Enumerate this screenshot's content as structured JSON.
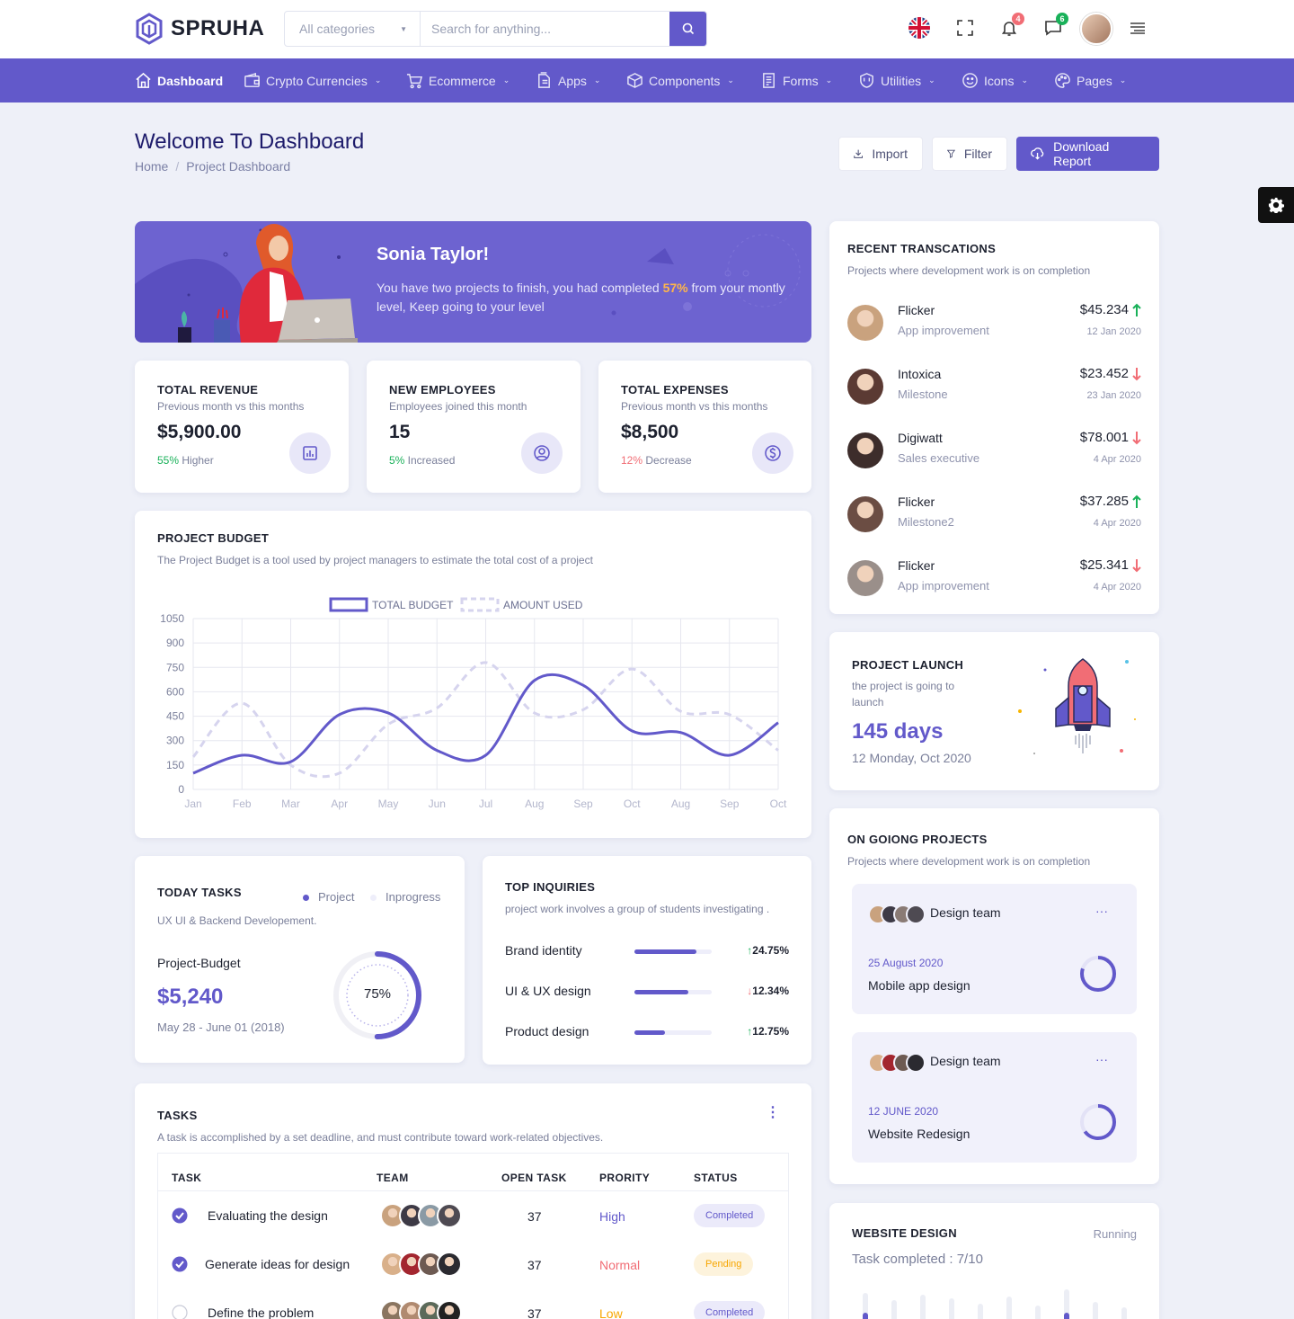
{
  "brand": {
    "name": "SPRUHA"
  },
  "search": {
    "category": "All categories",
    "placeholder": "Search for anything..."
  },
  "header": {
    "notifications_count": "4",
    "messages_count": "6"
  },
  "nav": {
    "items": [
      {
        "label": "Dashboard",
        "icon": "home-icon"
      },
      {
        "label": "Crypto Currencies",
        "icon": "wallet-icon"
      },
      {
        "label": "Ecommerce",
        "icon": "cart-icon"
      },
      {
        "label": "Apps",
        "icon": "files-icon"
      },
      {
        "label": "Components",
        "icon": "box-icon"
      },
      {
        "label": "Forms",
        "icon": "form-icon"
      },
      {
        "label": "Utilities",
        "icon": "shield-icon"
      },
      {
        "label": "Icons",
        "icon": "smile-icon"
      },
      {
        "label": "Pages",
        "icon": "palette-icon"
      }
    ]
  },
  "page": {
    "title": "Welcome To Dashboard",
    "breadcrumb": [
      "Home",
      "/",
      "Project Dashboard"
    ],
    "import_label": "Import",
    "filter_label": "Filter",
    "download_label": "Download Report"
  },
  "welcome": {
    "name": "Sonia Taylor!",
    "text_before": "You have two projects to finish, you had completed ",
    "highlight": "57%",
    "text_after": " from your montly level, Keep going to your level"
  },
  "stats": [
    {
      "title": "TOTAL REVENUE",
      "sub": "Previous month vs this months",
      "value": "$5,900.00",
      "change": "55%",
      "change_label": " Higher",
      "change_color": "#19b159",
      "icon": "chart-icon"
    },
    {
      "title": "NEW EMPLOYEES",
      "sub": "Employees joined this month",
      "value": "15",
      "change": "5%",
      "change_label": " Increased",
      "change_color": "#19b159",
      "icon": "user-circle-icon"
    },
    {
      "title": "TOTAL EXPENSES",
      "sub": "Previous month vs this months",
      "value": "$8,500",
      "change": "12%",
      "change_label": " Decrease",
      "change_color": "#f16d75",
      "icon": "dollar-icon"
    }
  ],
  "budget": {
    "title": "PROJECT BUDGET",
    "sub": "The Project Budget is a tool used by project managers to estimate the total cost of a project"
  },
  "chart_data": {
    "type": "line",
    "categories": [
      "Jan",
      "Feb",
      "Mar",
      "Apr",
      "May",
      "Jun",
      "Jul",
      "Aug",
      "Sep",
      "Oct",
      "Aug",
      "Sep",
      "Oct"
    ],
    "series": [
      {
        "name": "TOTAL BUDGET",
        "values": [
          100,
          210,
          170,
          460,
          470,
          240,
          210,
          670,
          640,
          360,
          350,
          210,
          410
        ],
        "color": "#6259ca",
        "dashed": false
      },
      {
        "name": "AMOUNT USED",
        "values": [
          200,
          530,
          150,
          100,
          400,
          500,
          780,
          470,
          490,
          740,
          480,
          460,
          240
        ],
        "color": "#d6d4ee",
        "dashed": true
      }
    ],
    "yticks": [
      0,
      150,
      300,
      450,
      600,
      750,
      900,
      1050
    ],
    "ylim": [
      0,
      1050
    ],
    "grid": true,
    "legend": "top"
  },
  "transactions": {
    "title": "RECENT TRANSCATIONS",
    "sub": "Projects where development work is on completion",
    "items": [
      {
        "name": "Flicker",
        "role": "App improvement",
        "amount": "$45.234",
        "date": "12 Jan 2020",
        "dir": "up",
        "avatar": "#c9a27e"
      },
      {
        "name": "Intoxica",
        "role": "Milestone",
        "amount": "$23.452",
        "date": "23 Jan 2020",
        "dir": "down",
        "avatar": "#5b3a33"
      },
      {
        "name": "Digiwatt",
        "role": "Sales executive",
        "amount": "$78.001",
        "date": "4 Apr 2020",
        "dir": "down",
        "avatar": "#3d2d2b"
      },
      {
        "name": "Flicker",
        "role": "Milestone2",
        "amount": "$37.285",
        "date": "4 Apr 2020",
        "dir": "up",
        "avatar": "#6b4d43"
      },
      {
        "name": "Flicker",
        "role": "App improvement",
        "amount": "$25.341",
        "date": "4 Apr 2020",
        "dir": "down",
        "avatar": "#9a8f8a"
      }
    ]
  },
  "launch": {
    "title": "PROJECT LAUNCH",
    "sub": "the project is going to launch",
    "days": "145 days",
    "date": "12 Monday, Oct 2020"
  },
  "today_tasks": {
    "title": "TODAY TASKS",
    "legend": [
      "Project",
      "Inprogress"
    ],
    "sub": "UX UI & Backend Developement.",
    "label": "Project-Budget",
    "amount": "$5,240",
    "range": "May 28 - June 01 (2018)",
    "progress": 0.75,
    "progress_label": "75%"
  },
  "inquiries": {
    "title": "TOP INQUIRIES",
    "sub": "project work involves a group of students investigating .",
    "items": [
      {
        "label": "Brand identity",
        "pct": "24.75%",
        "dir": "up",
        "fill": 0.8
      },
      {
        "label": "UI & UX design",
        "pct": "12.34%",
        "dir": "down",
        "fill": 0.7
      },
      {
        "label": "Product design",
        "pct": "12.75%",
        "dir": "up",
        "fill": 0.4
      }
    ]
  },
  "ongoing": {
    "title": "ON GOIONG PROJECTS",
    "sub": "Projects where development work is on completion",
    "items": [
      {
        "team": "Design team",
        "date": "25 August 2020",
        "name": "Mobile app design",
        "more": "···",
        "progress": 0.8
      },
      {
        "team": "Design team",
        "date": "12 JUNE 2020",
        "name": "Website Redesign",
        "more": "···",
        "progress": 0.65
      }
    ]
  },
  "tasks": {
    "title": "TASKS",
    "sub": "A task is accomplished by a set deadline, and must contribute toward work-related objectives.",
    "columns": [
      "TASK",
      "TEAM",
      "OPEN TASK",
      "PRORITY",
      "STATUS"
    ],
    "rows": [
      {
        "task": "Evaluating the design",
        "checked": true,
        "open": "37",
        "priority": "High",
        "priority_color": "#6259ca",
        "status": "Completed",
        "status_bg": "#ebeafa",
        "status_color": "#6259ca"
      },
      {
        "task": "Generate ideas for design",
        "checked": true,
        "open": "37",
        "priority": "Normal",
        "priority_color": "#f16d75",
        "status": "Pending",
        "status_bg": "#fdf3dc",
        "status_color": "#f7a600"
      },
      {
        "task": "Define the problem",
        "checked": false,
        "open": "37",
        "priority": "Low",
        "priority_color": "#f7a600",
        "status": "Completed",
        "status_bg": "#ebeafa",
        "status_color": "#6259ca"
      }
    ]
  },
  "website_design": {
    "title": "WEBSITE DESIGN",
    "status": "Running",
    "completed": "Task completed : 7/10"
  },
  "colors": {
    "primary": "#6259ca",
    "success": "#19b159",
    "danger": "#f16d75",
    "warning": "#f7a600"
  }
}
